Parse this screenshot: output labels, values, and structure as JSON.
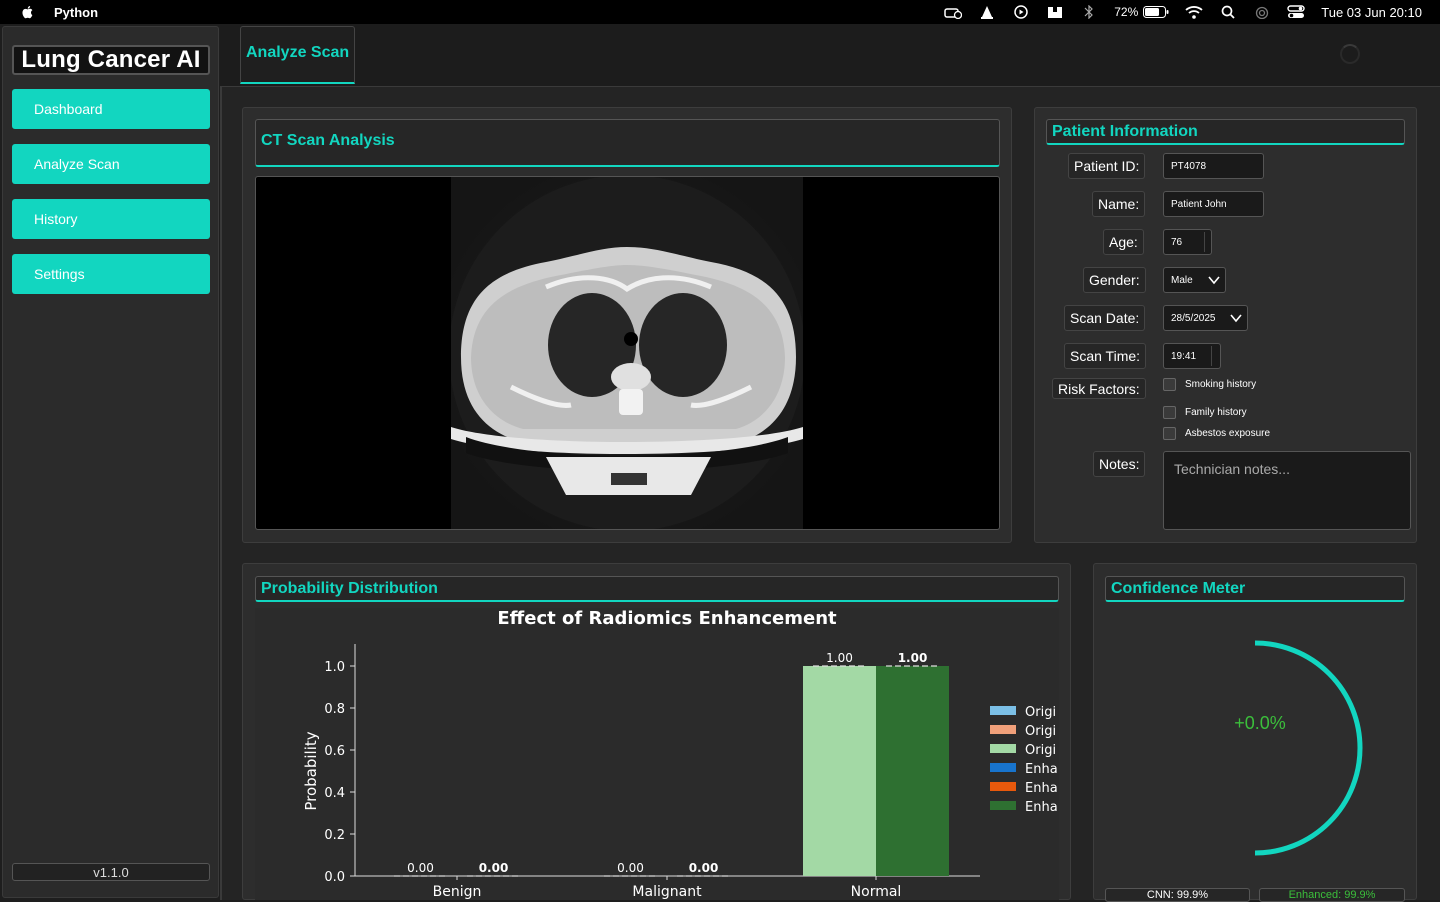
{
  "menubar": {
    "app_name": "Python",
    "battery": "72%",
    "clock": "Tue 03 Jun  20:10",
    "icons": [
      "apple-icon",
      "drive-icon",
      "cone-icon",
      "play-icon",
      "display-icon",
      "bluetooth-icon",
      "battery-icon",
      "wifi-icon",
      "search-icon",
      "airdrop-icon",
      "control-center-icon"
    ]
  },
  "sidebar": {
    "logo": "Lung Cancer AI",
    "items": [
      {
        "label": "Dashboard"
      },
      {
        "label": "Analyze Scan"
      },
      {
        "label": "History"
      },
      {
        "label": "Settings"
      }
    ],
    "version": "v1.1.0"
  },
  "tab": {
    "label": "Analyze Scan"
  },
  "ct_panel": {
    "title": "CT Scan Analysis"
  },
  "patient": {
    "title": "Patient Information",
    "fields": {
      "patient_id": {
        "label": "Patient ID:",
        "value": "PT4078"
      },
      "name": {
        "label": "Name:",
        "value": "Patient John"
      },
      "age": {
        "label": "Age:",
        "value": "76"
      },
      "gender": {
        "label": "Gender:",
        "value": "Male"
      },
      "scan_date": {
        "label": "Scan Date:",
        "value": "28/5/2025"
      },
      "scan_time": {
        "label": "Scan Time:",
        "value": "19:41"
      },
      "risk_factors": {
        "label": "Risk Factors:"
      },
      "notes": {
        "label": "Notes:",
        "placeholder": "Technician notes..."
      }
    },
    "risk_options": [
      "Smoking history",
      "Family history",
      "Asbestos exposure"
    ]
  },
  "probability": {
    "title": "Probability Distribution"
  },
  "confidence": {
    "title": "Confidence Meter",
    "value_text": "+0.0%",
    "fraction": 0.5,
    "chips": [
      "CNN: 99.9%",
      "Enhanced: 99.9%"
    ],
    "colors": {
      "arc": "#12d6c0",
      "text": "#3bbf3b",
      "chip2": "#3bbf3b"
    }
  },
  "chart_data": {
    "type": "bar",
    "title": "Effect of Radiomics Enhancement",
    "xlabel": "",
    "ylabel": "Probability",
    "categories": [
      "Benign",
      "Malignant",
      "Normal"
    ],
    "ylim": [
      0,
      1.1
    ],
    "yticks": [
      "0.0",
      "0.2",
      "0.4",
      "0.6",
      "0.8",
      "1.0"
    ],
    "series": [
      {
        "name": "Origi",
        "values": [
          0,
          0,
          1.0
        ],
        "labels": [
          "0.00",
          "0.00",
          "1.00"
        ],
        "bold": false
      },
      {
        "name": "Enha",
        "values": [
          0,
          0,
          1.0
        ],
        "labels": [
          "0.00",
          "0.00",
          "1.00"
        ],
        "bold": true
      }
    ],
    "bar_colors": {
      "original_normal": "#a3d9a5",
      "enhanced_normal": "#2e7031"
    },
    "legend": [
      {
        "name": "Origi",
        "color": "#7bbfe6"
      },
      {
        "name": "Origi",
        "color": "#f0a07a"
      },
      {
        "name": "Origi",
        "color": "#a3d9a5"
      },
      {
        "name": "Enha",
        "color": "#1874cd"
      },
      {
        "name": "Enha",
        "color": "#e8590c"
      },
      {
        "name": "Enha",
        "color": "#2e7031"
      }
    ],
    "legend_placement": "right",
    "grid": false
  }
}
